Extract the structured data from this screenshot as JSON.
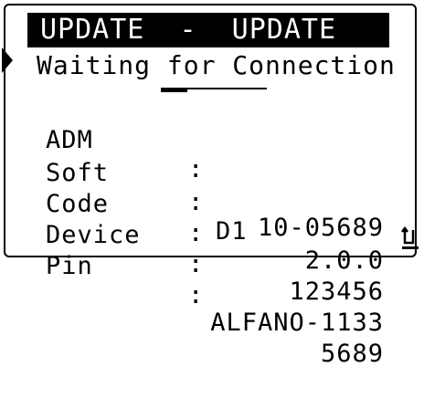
{
  "header": {
    "title": "UPDATE  -  UPDATE"
  },
  "status": {
    "message": "Waiting for Connection",
    "progress": 0.25
  },
  "rows": [
    {
      "label": "ADM",
      "colon": ":",
      "mid": "",
      "value": "10-05689"
    },
    {
      "label": "Soft",
      "colon": ":",
      "mid": "D1",
      "value": "2.0.0"
    },
    {
      "label": "Code",
      "colon": ":",
      "mid": "",
      "value": "123456"
    },
    {
      "label": "Device",
      "colon": ":",
      "mid": "",
      "value": "ALFANO-1133"
    },
    {
      "label": "Pin",
      "colon": ":",
      "mid": "",
      "value": "5689"
    }
  ],
  "icons": {
    "side_arrow": "right-pointer-icon",
    "back": "back-arrow-icon"
  }
}
